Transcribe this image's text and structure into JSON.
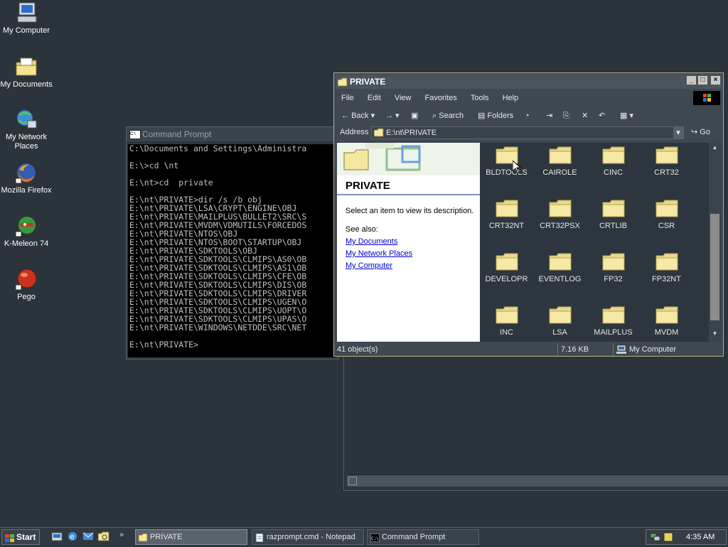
{
  "desktop": {
    "icons": [
      {
        "label": "My Computer",
        "icon": "my-computer-icon"
      },
      {
        "label": "My Documents",
        "icon": "my-documents-icon"
      },
      {
        "label": "My Network Places",
        "icon": "network-places-icon"
      },
      {
        "label": "Mozilla Firefox",
        "icon": "firefox-icon"
      },
      {
        "label": "K-Meleon 74",
        "icon": "k-meleon-icon"
      },
      {
        "label": "Pego",
        "icon": "pego-icon"
      }
    ]
  },
  "cmd": {
    "title": "Command Prompt",
    "lines": [
      "C:\\Documents and Settings\\Administra",
      "",
      "E:\\>cd \\nt",
      "",
      "E:\\nt>cd  private",
      "",
      "E:\\nt\\PRIVATE>dir /s /b obj",
      "E:\\nt\\PRIVATE\\LSA\\CRYPT\\ENGINE\\OBJ",
      "E:\\nt\\PRIVATE\\MAILPLUS\\BULLET2\\SRC\\S",
      "E:\\nt\\PRIVATE\\MVDM\\VDMUTILS\\FORCEDOS",
      "E:\\nt\\PRIVATE\\NTOS\\OBJ",
      "E:\\nt\\PRIVATE\\NTOS\\BOOT\\STARTUP\\OBJ",
      "E:\\nt\\PRIVATE\\SDKTOOLS\\OBJ",
      "E:\\nt\\PRIVATE\\SDKTOOLS\\CLMIPS\\AS0\\OB",
      "E:\\nt\\PRIVATE\\SDKTOOLS\\CLMIPS\\AS1\\OB",
      "E:\\nt\\PRIVATE\\SDKTOOLS\\CLMIPS\\CFE\\OB",
      "E:\\nt\\PRIVATE\\SDKTOOLS\\CLMIPS\\DIS\\OB",
      "E:\\nt\\PRIVATE\\SDKTOOLS\\CLMIPS\\DRIVER",
      "E:\\nt\\PRIVATE\\SDKTOOLS\\CLMIPS\\UGEN\\O",
      "E:\\nt\\PRIVATE\\SDKTOOLS\\CLMIPS\\UOPT\\O",
      "E:\\nt\\PRIVATE\\SDKTOOLS\\CLMIPS\\UPAS\\O",
      "E:\\nt\\PRIVATE\\WINDOWS\\NETDDE\\SRC\\NET",
      "",
      "E:\\nt\\PRIVATE>"
    ]
  },
  "explorer": {
    "title": "PRIVATE",
    "menu": [
      "File",
      "Edit",
      "View",
      "Favorites",
      "Tools",
      "Help"
    ],
    "toolbar": {
      "back": "Back",
      "search": "Search",
      "folders": "Folders"
    },
    "address": {
      "label": "Address",
      "value": "E:\\nt\\PRIVATE",
      "go": "Go"
    },
    "left": {
      "title": "PRIVATE",
      "description": "Select an item to view its description.",
      "see_also": "See also:",
      "links": [
        "My Documents",
        "My Network Places",
        "My Computer"
      ]
    },
    "folders": [
      "BLDTOOLS",
      "CAIROLE",
      "CINC",
      "CRT32",
      "CRT32NT",
      "CRT32PSX",
      "CRTLIB",
      "CSR",
      "DEVELOPR",
      "EVENTLOG",
      "FP32",
      "FP32NT",
      "INC",
      "LSA",
      "MAILPLUS",
      "MVDM"
    ],
    "status": {
      "objects": "41 object(s)",
      "size": "7.16 KB",
      "zone": "My Computer"
    }
  },
  "taskbar": {
    "start": "Start",
    "buttons": [
      "PRIVATE",
      "razprompt.cmd - Notepad",
      "Command Prompt"
    ],
    "clock": "4:35 AM"
  },
  "colors": {
    "desktop": "#2b333b",
    "folder": "#f4e7a0",
    "link": "#0000cc"
  }
}
